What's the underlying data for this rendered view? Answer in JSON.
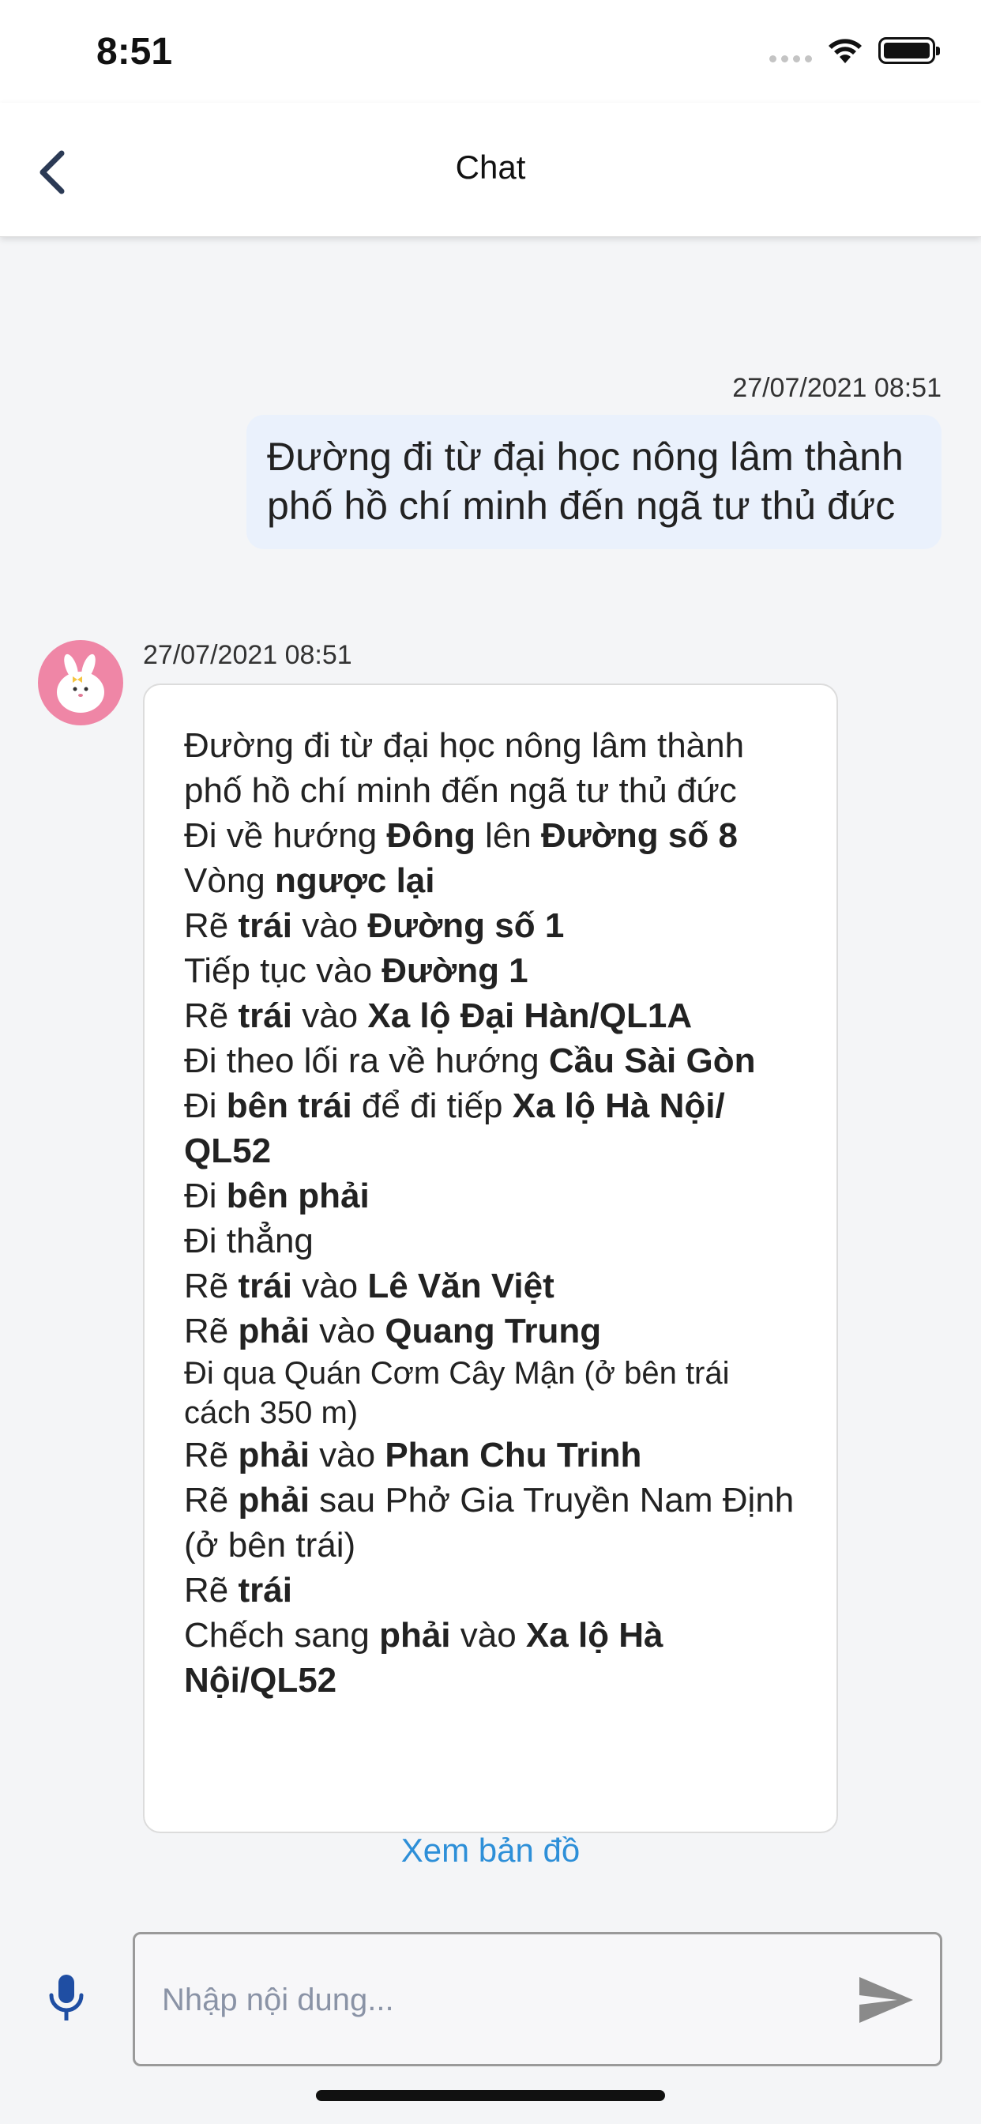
{
  "status_bar": {
    "time": "8:51"
  },
  "nav": {
    "title": "Chat"
  },
  "messages": {
    "user": {
      "timestamp": "27/07/2021 08:51",
      "text": "Đường đi từ đại học nông lâm thành phố hồ chí minh đến ngã tư thủ đức"
    },
    "bot": {
      "timestamp": "27/07/2021 08:51",
      "lines": [
        {
          "parts": [
            {
              "t": "Đường đi từ đại học nông lâm thành phố hồ chí minh đến ngã tư thủ đức"
            }
          ]
        },
        {
          "parts": [
            {
              "t": "Đi về hướng "
            },
            {
              "t": "Đông",
              "b": true
            },
            {
              "t": " lên "
            },
            {
              "t": "Đường số 8",
              "b": true
            }
          ]
        },
        {
          "parts": [
            {
              "t": "Vòng "
            },
            {
              "t": "ngược lại",
              "b": true
            }
          ]
        },
        {
          "parts": [
            {
              "t": "Rẽ "
            },
            {
              "t": "trái",
              "b": true
            },
            {
              "t": " vào "
            },
            {
              "t": "Đường số 1",
              "b": true
            }
          ]
        },
        {
          "parts": [
            {
              "t": "Tiếp tục vào "
            },
            {
              "t": "Đường 1",
              "b": true
            }
          ]
        },
        {
          "parts": [
            {
              "t": "Rẽ "
            },
            {
              "t": "trái",
              "b": true
            },
            {
              "t": " vào "
            },
            {
              "t": "Xa lộ Đại Hàn/QL1A",
              "b": true
            }
          ]
        },
        {
          "parts": [
            {
              "t": "Đi theo lối ra về hướng "
            },
            {
              "t": "Cầu Sài Gòn",
              "b": true
            }
          ]
        },
        {
          "parts": [
            {
              "t": "Đi "
            },
            {
              "t": "bên trái",
              "b": true
            },
            {
              "t": " để đi tiếp "
            },
            {
              "t": "Xa lộ Hà Nội/ QL52",
              "b": true
            }
          ]
        },
        {
          "parts": [
            {
              "t": "Đi "
            },
            {
              "t": "bên phải",
              "b": true
            }
          ]
        },
        {
          "parts": [
            {
              "t": "Đi thẳng"
            }
          ]
        },
        {
          "parts": [
            {
              "t": "Rẽ "
            },
            {
              "t": "trái",
              "b": true
            },
            {
              "t": " vào "
            },
            {
              "t": "Lê Văn Việt",
              "b": true
            }
          ]
        },
        {
          "parts": [
            {
              "t": "Rẽ "
            },
            {
              "t": "phải",
              "b": true
            },
            {
              "t": " vào "
            },
            {
              "t": "Quang Trung",
              "b": true
            }
          ]
        },
        {
          "small": true,
          "parts": [
            {
              "t": "Đi qua Quán Cơm Cây Mận (ở bên trái cách 350 m)"
            }
          ]
        },
        {
          "parts": [
            {
              "t": "Rẽ "
            },
            {
              "t": "phải",
              "b": true
            },
            {
              "t": " vào "
            },
            {
              "t": "Phan Chu Trinh",
              "b": true
            }
          ]
        },
        {
          "parts": [
            {
              "t": "Rẽ "
            },
            {
              "t": "phải",
              "b": true
            },
            {
              "t": " sau Phở Gia Truyền Nam Định (ở bên trái)"
            }
          ]
        },
        {
          "parts": [
            {
              "t": "Rẽ "
            },
            {
              "t": "trái",
              "b": true
            }
          ]
        },
        {
          "parts": [
            {
              "t": "Chếch sang "
            },
            {
              "t": "phải",
              "b": true
            },
            {
              "t": " vào "
            },
            {
              "t": "Xa lộ Hà Nội/QL52",
              "b": true
            }
          ]
        }
      ],
      "map_link": "Xem bản đồ"
    }
  },
  "composer": {
    "placeholder": "Nhập nội dung..."
  },
  "colors": {
    "accent": "#2d8fd8",
    "user_bubble": "#eaf1fc",
    "avatar_bg": "#ef86a6",
    "nav_icon": "#2b3a55",
    "mic": "#1f4ea3"
  },
  "icons": {
    "back": "chevron-left-icon",
    "mic": "microphone-icon",
    "send": "send-icon",
    "wifi": "wifi-icon",
    "battery": "battery-icon",
    "signal": "cellular-signal-icon"
  }
}
